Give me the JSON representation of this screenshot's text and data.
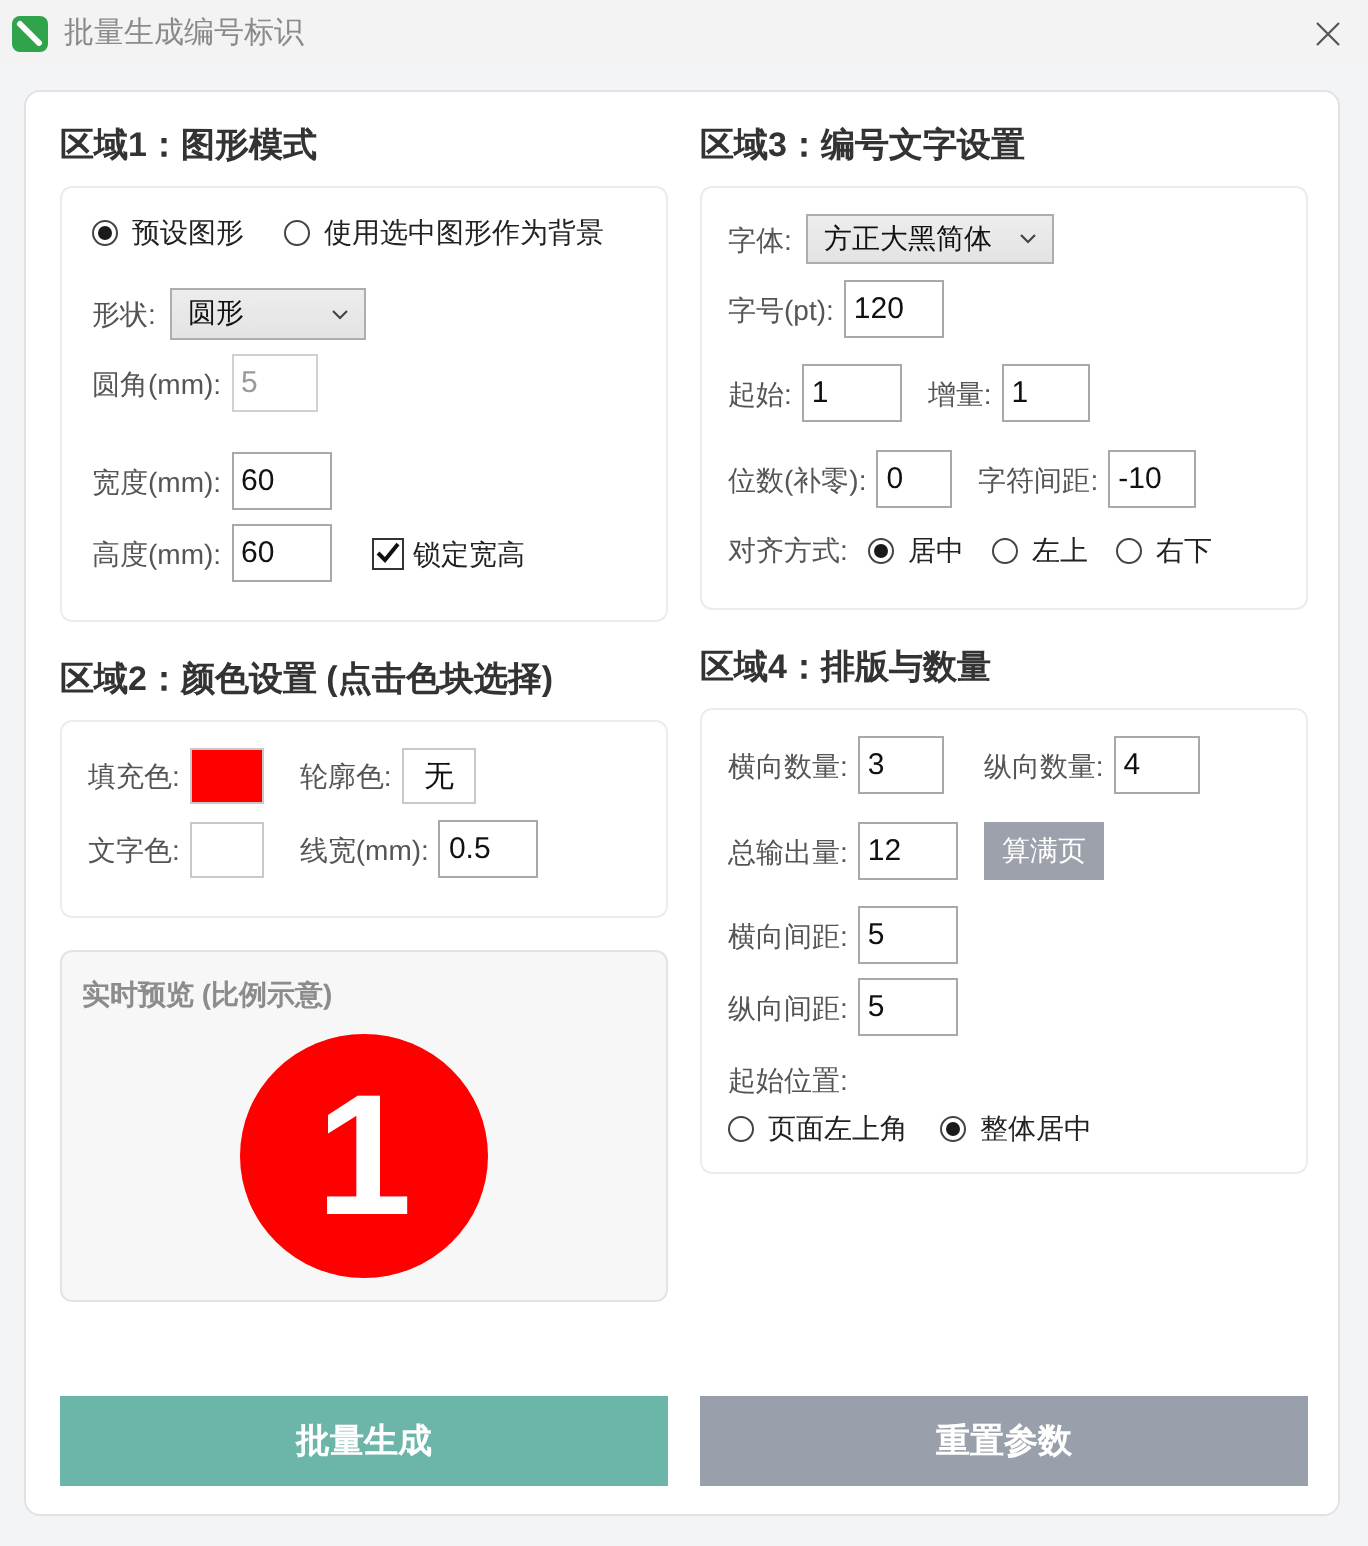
{
  "window": {
    "title": "批量生成编号标识"
  },
  "area1": {
    "title": "区域1：图形模式",
    "modes": [
      {
        "label": "预设图形",
        "selected": true
      },
      {
        "label": "使用选中图形作为背景",
        "selected": false
      }
    ],
    "shape": {
      "label": "形状:",
      "value": "圆形"
    },
    "fields": [
      {
        "label": "圆角(mm):",
        "value": "5",
        "disabled": true
      },
      {
        "label": "宽度(mm):",
        "value": "60",
        "disabled": false
      },
      {
        "label": "高度(mm):",
        "value": "60",
        "disabled": false,
        "lock": {
          "label": "锁定宽高",
          "checked": true
        }
      }
    ]
  },
  "area2": {
    "title": "区域2：颜色设置 (点击色块选择)",
    "items": [
      {
        "kind": "swatch",
        "label": "填充色:",
        "color": "#ff0000"
      },
      {
        "kind": "swatch",
        "label": "轮廓色:",
        "value": "无"
      },
      {
        "kind": "swatch",
        "label": "文字色:",
        "color": "#ffffff"
      },
      {
        "kind": "input",
        "label": "线宽(mm):",
        "value": "0.5"
      }
    ]
  },
  "preview": {
    "title": "实时预览 (比例示意)",
    "number": "1"
  },
  "area3": {
    "title": "区域3：编号文字设置",
    "font": {
      "label": "字体:",
      "value": "方正大黑简体"
    },
    "rows": [
      {
        "fields": [
          {
            "label": "字号(pt):",
            "value": "120"
          }
        ]
      },
      {
        "fields": [
          {
            "label": "起始:",
            "value": "1"
          },
          {
            "label": "增量:",
            "value": "1"
          }
        ]
      },
      {
        "fields": [
          {
            "label": "位数(补零):",
            "value": "0"
          },
          {
            "label": "字符间距:",
            "value": "-10"
          }
        ]
      }
    ],
    "align": {
      "label": "对齐方式:",
      "options": [
        {
          "label": "居中",
          "selected": true
        },
        {
          "label": "左上",
          "selected": false
        },
        {
          "label": "右下",
          "selected": false
        }
      ]
    }
  },
  "area4": {
    "title": "区域4：排版与数量",
    "rows": [
      {
        "fields": [
          {
            "label": "横向数量:",
            "value": "3"
          },
          {
            "label": "纵向数量:",
            "value": "4"
          }
        ]
      },
      {
        "fields": [
          {
            "label": "总输出量:",
            "value": "12"
          }
        ],
        "button": "算满页"
      },
      {
        "fields": [
          {
            "label": "横向间距:",
            "value": "5"
          }
        ]
      },
      {
        "fields": [
          {
            "label": "纵向间距:",
            "value": "5"
          }
        ]
      }
    ],
    "start": {
      "label": "起始位置:",
      "options": [
        {
          "label": "页面左上角",
          "selected": false
        },
        {
          "label": "整体居中",
          "selected": true
        }
      ]
    }
  },
  "buttons": [
    {
      "label": "批量生成",
      "kind": "primary"
    },
    {
      "label": "重置参数",
      "kind": "secondary"
    }
  ]
}
